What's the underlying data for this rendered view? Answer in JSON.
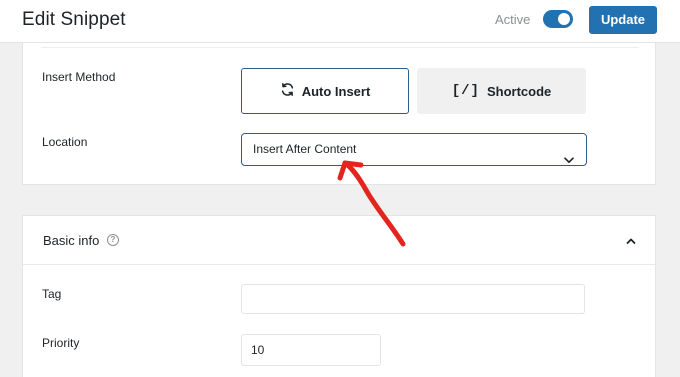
{
  "header": {
    "title": "Edit Snippet",
    "active_label": "Active",
    "active_toggle_on": true,
    "update_label": "Update"
  },
  "insert": {
    "method_label": "Insert Method",
    "auto_label": "Auto Insert",
    "shortcode_glyph": "[/]",
    "shortcode_label": "Shortcode",
    "selected_method": "Auto Insert",
    "location_label": "Location",
    "location_value": "Insert After Content"
  },
  "basic_info": {
    "title": "Basic info",
    "tag_label": "Tag",
    "tag_value": "",
    "priority_label": "Priority",
    "priority_value": "10"
  },
  "colors": {
    "accent": "#2271b1",
    "annotation_arrow": "#e3261d"
  },
  "icons": {
    "auto_insert": "refresh-icon",
    "location": "chevron-down-icon",
    "help": "question-circle-icon",
    "collapse": "chevron-up-icon"
  }
}
